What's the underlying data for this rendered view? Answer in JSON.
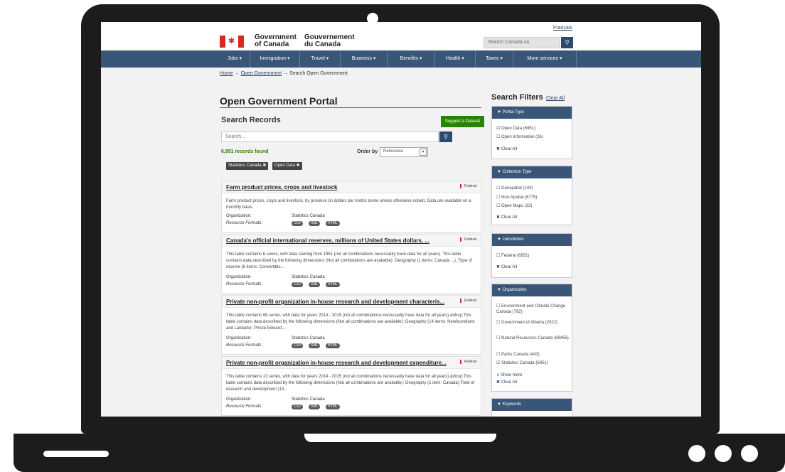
{
  "site": {
    "lang_toggle": "Français",
    "signature_en": [
      "Government",
      "of Canada"
    ],
    "signature_fr": [
      "Gouvernement",
      "du Canada"
    ],
    "search_placeholder": "Search Canada.ca"
  },
  "nav": [
    "Jobs ▾",
    "Immigration ▾",
    "Travel ▾",
    "Business ▾",
    "Benefits ▾",
    "Health ▾",
    "Taxes ▾",
    "More services ▾"
  ],
  "breadcrumb": {
    "home": "Home",
    "og": "Open Government",
    "current": "Search Open Government",
    "sep": "→"
  },
  "main": {
    "title": "Open Government Portal",
    "section": "Search Records",
    "suggest_label": "Suggest a Dataset",
    "search_placeholder": "Search...",
    "count": "6,951 records found",
    "orderby_label": "Order by",
    "orderby_value": "Relevance",
    "chips": [
      "Statistics Canada ✖",
      "Open Data ✖"
    ]
  },
  "records": [
    {
      "title": "Farm product prices, crops and livestock",
      "jurisdiction": "Federal",
      "desc": "Farm product prices, crops and livestock, by province (in dollars per metric tonne unless otherwise noted). Data are available on a monthly basis.",
      "org_label": "Organization:",
      "org": "Statistics Canada",
      "formats_label": "Resource Formats:",
      "formats": [
        "CSV",
        "XML",
        "HTML"
      ]
    },
    {
      "title": "Canada's official international reserves, millions of United States dollars, ...",
      "jurisdiction": "Federal",
      "desc": "This table contains 6 series, with data starting from 1951 (not all combinations necessarily have data for all years). This table contains data described by the following dimensions (Not all combinations are available): Geography (1 items: Canada ...), Type of reserve (6 items: Convertible...",
      "org_label": "Organization:",
      "org": "Statistics Canada",
      "formats_label": "Resource Formats:",
      "formats": [
        "CSV",
        "XML",
        "HTML"
      ]
    },
    {
      "title": "Private non-profit organization in-house research and development characteris...",
      "jurisdiction": "Federal",
      "desc": "This table contains 98 series, with data for years 2014 - 2015 (not all combinations necessarily have data for all years).&nbsp;This table contains data described by the following dimensions (Not all combinations are available): Geography (14 items: Newfoundland and Labrador; Prince Edward...",
      "org_label": "Organization:",
      "org": "Statistics Canada",
      "formats_label": "Resource Formats:",
      "formats": [
        "CSV",
        "XML",
        "HTML"
      ]
    },
    {
      "title": "Private non-profit organization in-house research and development expenditure...",
      "jurisdiction": "Federal",
      "desc": "This table contains 13 series, with data for years 2014 - 2015 (not all combinations necessarily have data for all years).&nbsp;This table contains data described by the following dimensions (Not all combinations are available): Geography (1 item: Canada) Field of research and development (13...",
      "org_label": "Organization:",
      "org": "Statistics Canada",
      "formats_label": "Resource Formats:",
      "formats": [
        "CSV",
        "XML",
        "HTML"
      ]
    }
  ],
  "filters": {
    "title": "Search Filters",
    "clear_all": "Clear All",
    "panels": [
      {
        "heading": "▼ Portal Type",
        "options": [
          "☑ Open Data (6951)",
          "☐ Open Information (26)"
        ],
        "clear": "✖ Clear All"
      },
      {
        "heading": "▼ Collection Type",
        "options": [
          "☐ Geospatial (144)",
          "☐ Non-Spatial (6775)",
          "☐ Open Maps (32)"
        ],
        "clear": "✖ Clear All"
      },
      {
        "heading": "▼ Jurisdiction",
        "options": [
          "☐ Federal (6951)"
        ],
        "clear": "✖ Clear All"
      },
      {
        "heading": "▼ Organization",
        "options": [
          "☐ Environment and Climate Change Canada (792)",
          "☐ Government of Alberta (2022)",
          "☐ Natural Resources Canada (69455)",
          "☐ Parks Canada (443)",
          "☑ Statistics Canada (6951)"
        ],
        "show_more": "∨ Show more",
        "clear": "✖ Clear All"
      },
      {
        "heading": "▼ Keywords"
      }
    ]
  }
}
